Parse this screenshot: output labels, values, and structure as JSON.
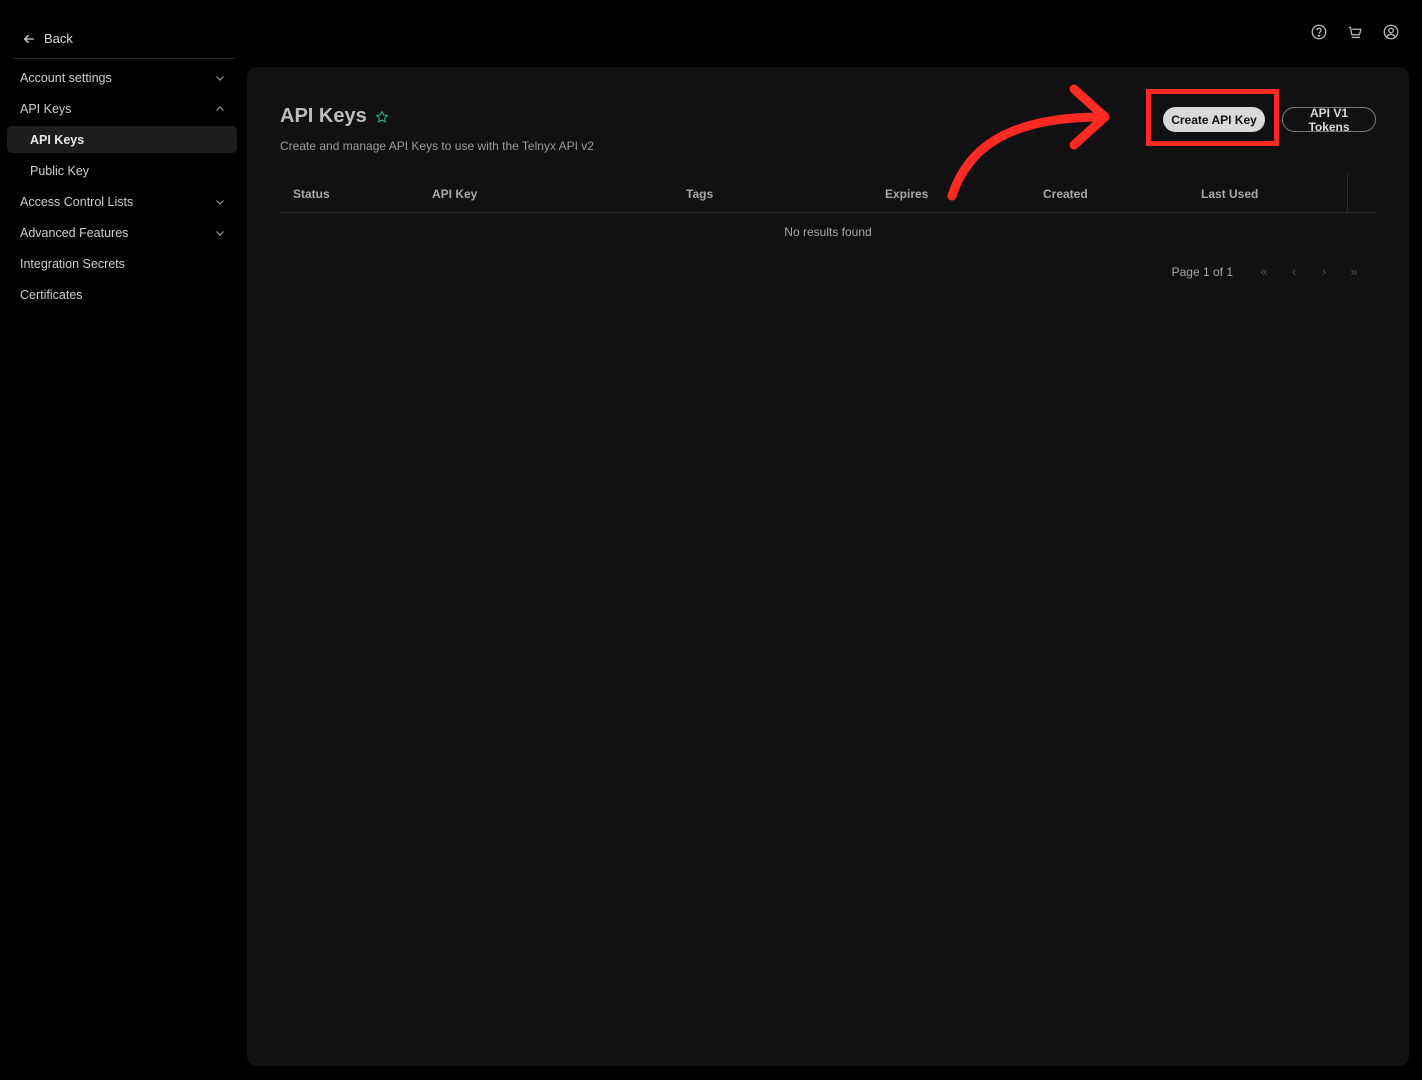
{
  "sidebar": {
    "back_label": "Back",
    "items": [
      {
        "label": "Account settings"
      },
      {
        "label": "API Keys"
      },
      {
        "label": "API Keys"
      },
      {
        "label": "Public Key"
      },
      {
        "label": "Access Control Lists"
      },
      {
        "label": "Advanced Features"
      },
      {
        "label": "Integration Secrets"
      },
      {
        "label": "Certificates"
      }
    ]
  },
  "header_icons": [
    "help-icon",
    "cart-icon",
    "user-account-icon"
  ],
  "main": {
    "title": "API Keys",
    "subtitle": "Create and manage API Keys to use with the Telnyx API v2",
    "buttons": {
      "create": "Create API Key",
      "v1_tokens": "API V1 Tokens"
    },
    "table": {
      "columns": [
        "Status",
        "API Key",
        "Tags",
        "Expires",
        "Created",
        "Last Used"
      ],
      "empty_message": "No results found"
    },
    "pagination": {
      "label": "Page 1 of 1"
    }
  },
  "colors": {
    "accent_star": "#2fb37a",
    "annotation": "#ff2a22",
    "panel_bg": "#111113"
  }
}
